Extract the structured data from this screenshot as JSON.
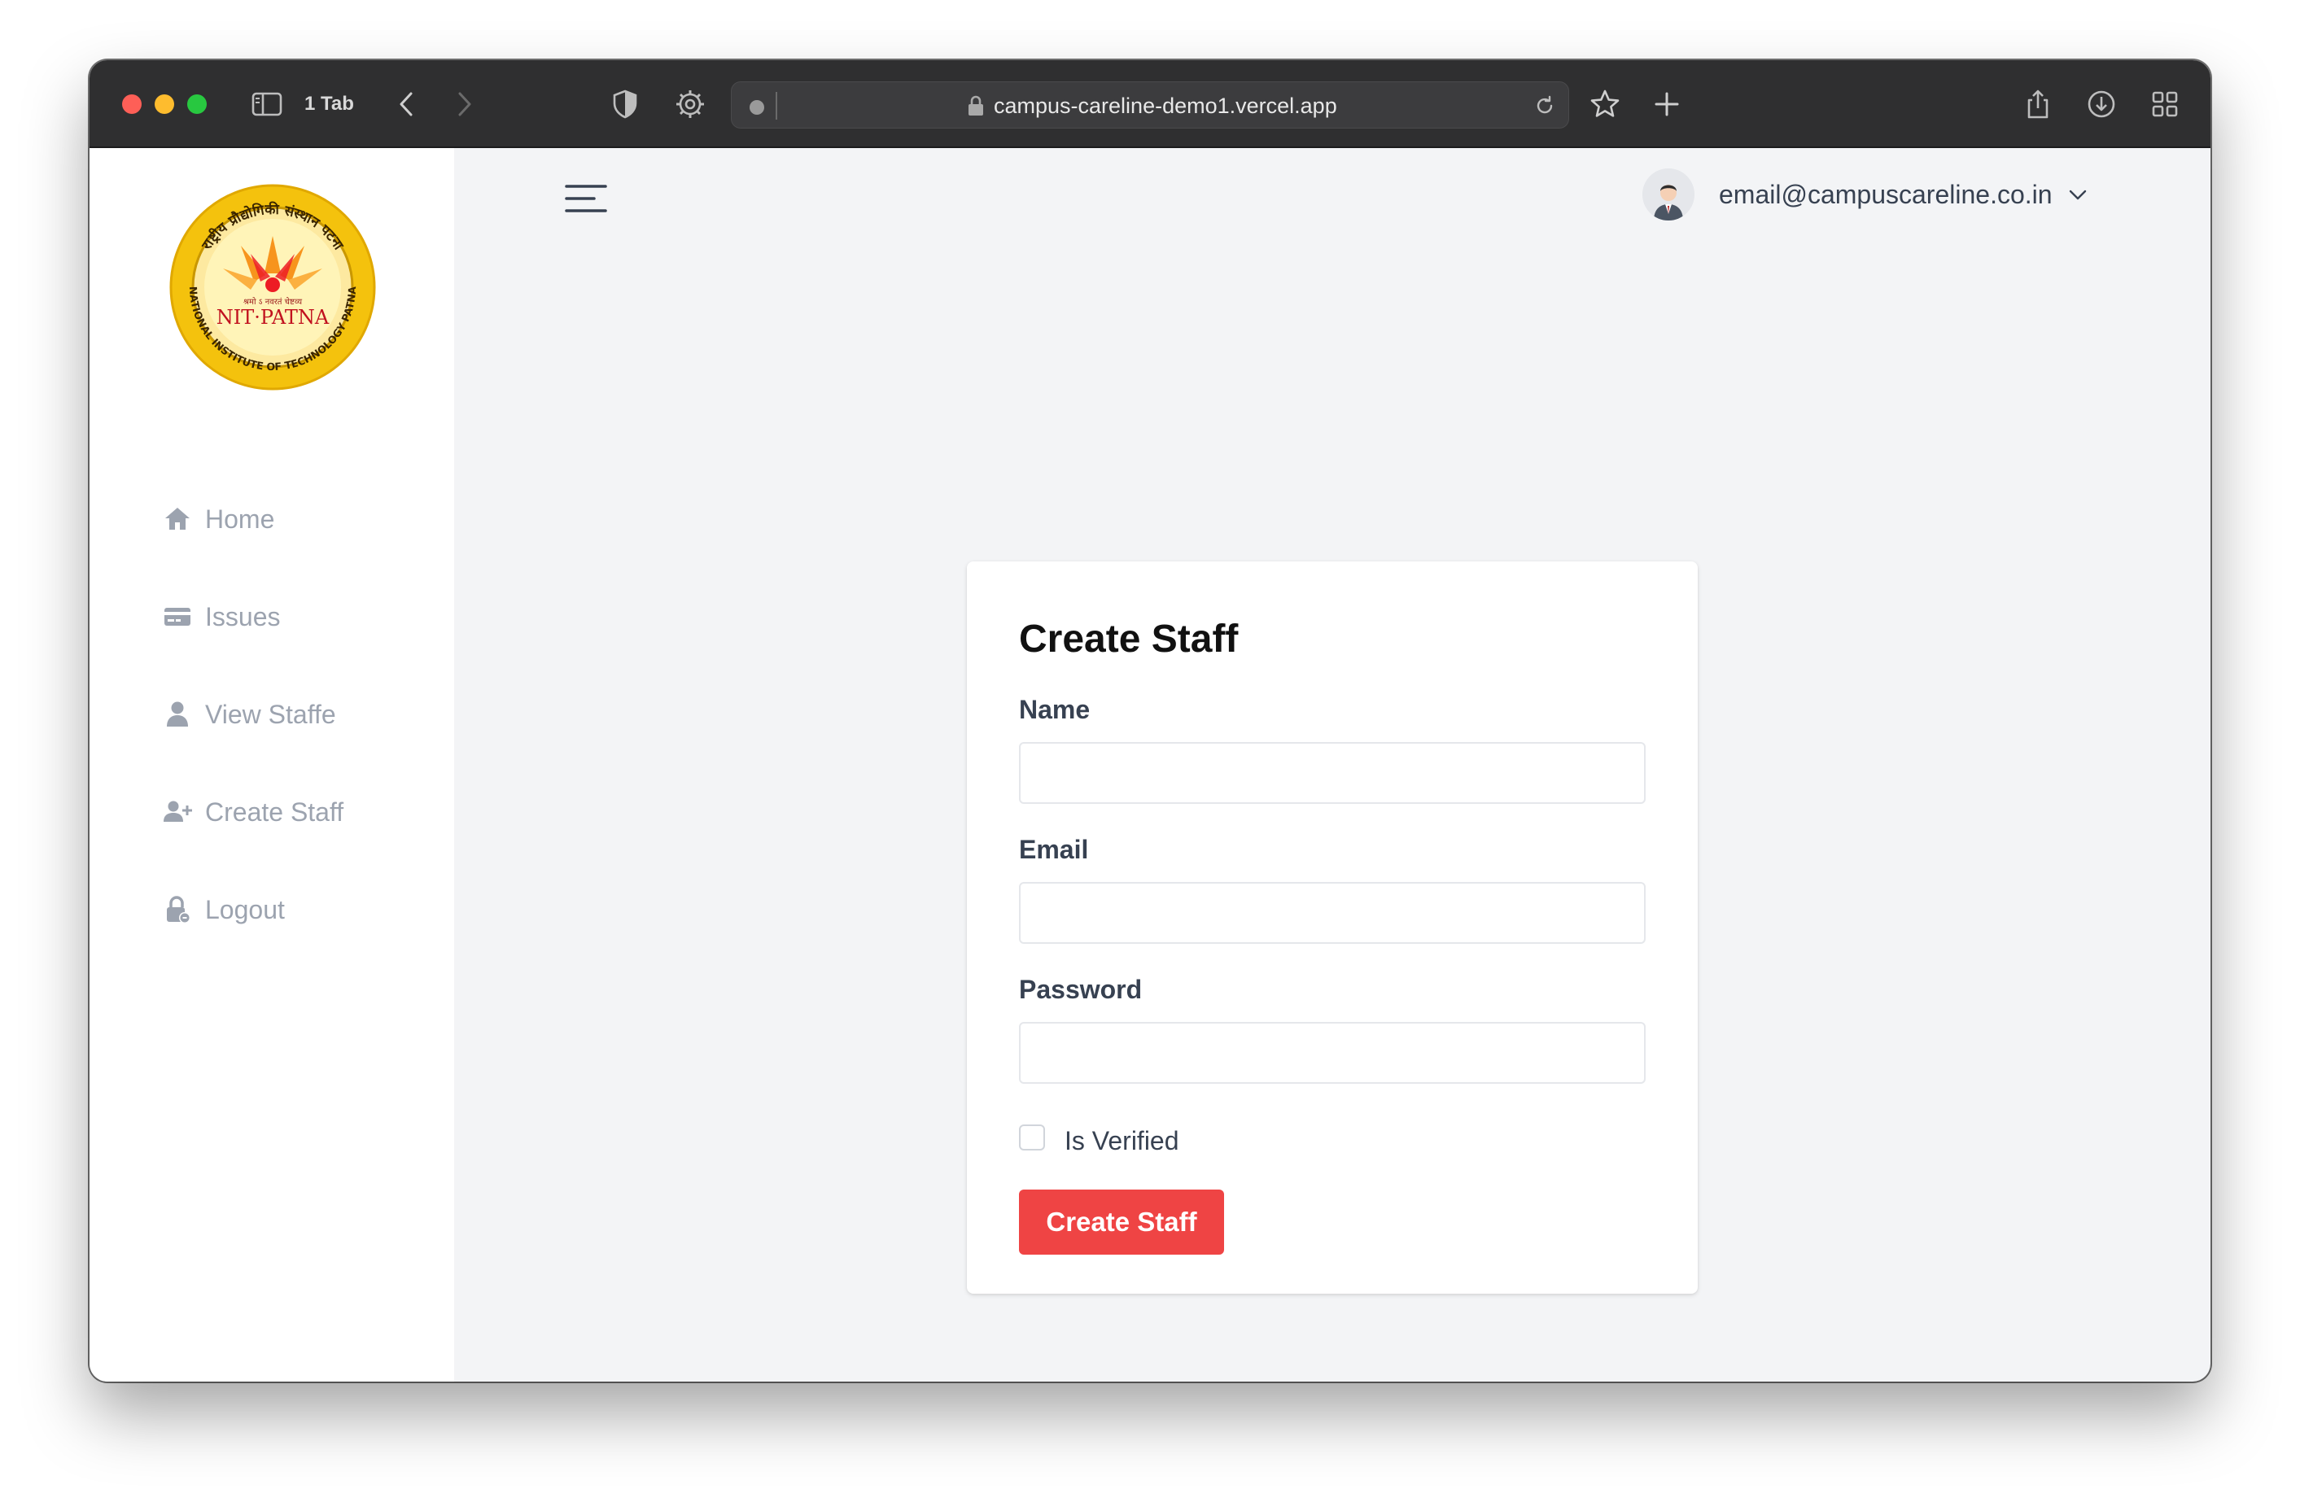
{
  "browser": {
    "tab_count": "1 Tab",
    "url": "campus-careline-demo1.vercel.app"
  },
  "sidebar": {
    "logo": {
      "top_text": "राष्ट्रीय प्रौद्योगिकी संस्थान पटना",
      "motto": "श्रमो ऽ नवरतं चेष्टव्य",
      "name": "NIT·PATNA",
      "bottom_text": "NATIONAL INSTITUTE OF TECHNOLOGY PATNA"
    },
    "items": [
      {
        "label": "Home",
        "icon": "home-icon"
      },
      {
        "label": "Issues",
        "icon": "card-icon"
      },
      {
        "label": "View Staffe",
        "icon": "user-icon"
      },
      {
        "label": "Create Staff",
        "icon": "user-plus-icon"
      },
      {
        "label": "Logout",
        "icon": "lock-icon"
      }
    ]
  },
  "header": {
    "user_email": "email@campuscareline.co.in"
  },
  "form": {
    "title": "Create Staff",
    "name_label": "Name",
    "name_value": "",
    "email_label": "Email",
    "email_value": "",
    "password_label": "Password",
    "password_value": "",
    "verified_label": "Is Verified",
    "verified_checked": false,
    "submit_label": "Create Staff"
  },
  "colors": {
    "accent": "#ef4444",
    "sidebar_text": "#9ca3af",
    "page_bg": "#f3f4f6"
  }
}
